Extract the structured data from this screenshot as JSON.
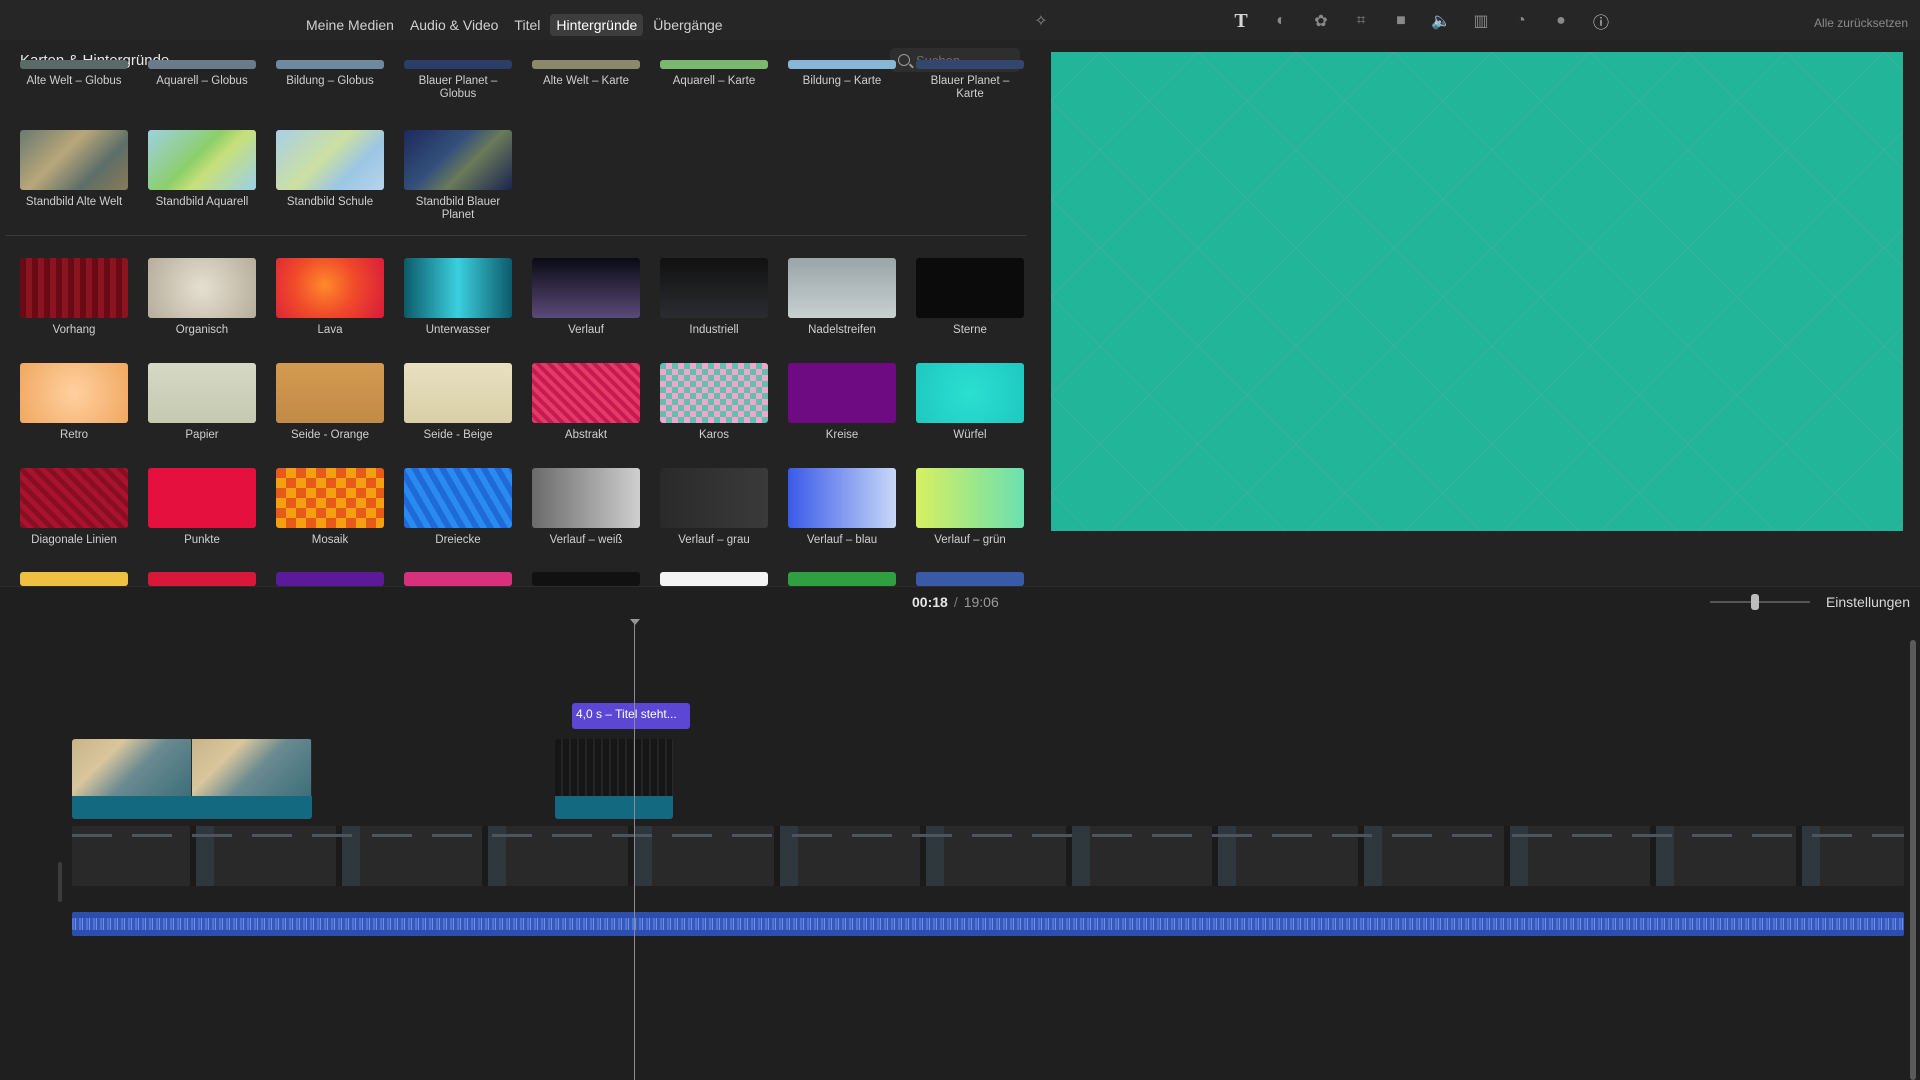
{
  "tabs": [
    {
      "label": "Meine Medien"
    },
    {
      "label": "Audio & Video"
    },
    {
      "label": "Titel"
    },
    {
      "label": "Hintergründe",
      "active": true
    },
    {
      "label": "Übergänge"
    }
  ],
  "toolbar": {
    "icons": [
      "magic-wand-icon",
      "title-T-icon",
      "color-balance-icon",
      "color-correction-icon",
      "crop-icon",
      "stabilization-icon",
      "volume-icon",
      "equalizer-icon",
      "speed-icon",
      "filter-icon",
      "info-icon"
    ],
    "reset_label": "Alle zurücksetzen"
  },
  "browser": {
    "title": "Karten & Hintergründe",
    "search_placeholder": "Suchen",
    "clipped_row": [
      {
        "label": "Alte Welt – Globus",
        "color": "#5a6a66"
      },
      {
        "label": "Aquarell – Globus",
        "color": "#6a7c8a"
      },
      {
        "label": "Bildung – Globus",
        "color": "#6f8aa0"
      },
      {
        "label": "Blauer Planet – Globus",
        "color": "#2c3d6a"
      },
      {
        "label": "Alte Welt – Karte",
        "color": "#8a8a6a"
      },
      {
        "label": "Aquarell – Karte",
        "color": "#7ab870"
      },
      {
        "label": "Bildung – Karte",
        "color": "#88b6d6"
      },
      {
        "label": "Blauer Planet – Karte",
        "color": "#34466e"
      }
    ],
    "maps": [
      {
        "label": "Standbild Alte Welt",
        "bg": "linear-gradient(135deg,#6a7a70,#b9a77a 40%,#5d6e68 70%,#8a7a58)"
      },
      {
        "label": "Standbild Aquarell",
        "bg": "linear-gradient(135deg,#9fd0e0,#8ccf6a 45%,#c8e07a 60%,#9ad0e8)"
      },
      {
        "label": "Standbild Schule",
        "bg": "linear-gradient(135deg,#a8cfe6,#cde0a0 45%,#9cc6e4 70%,#b6d4ec)"
      },
      {
        "label": "Standbild Blauer Planet",
        "bg": "linear-gradient(135deg,#1c2a5e,#34507a 40%,#6a7a5a 60%,#1a2450)"
      }
    ],
    "backgrounds": [
      {
        "label": "Vorhang",
        "bg": "repeating-linear-gradient(90deg,#6a0a14 0 6px,#8a1420 6px 12px)"
      },
      {
        "label": "Organisch",
        "bg": "radial-gradient(circle,#e6e0d2,#b6ad9a)"
      },
      {
        "label": "Lava",
        "bg": "radial-gradient(circle at 45% 45%,#ff8a2a,#f04a2a 45%,#d81a3a)"
      },
      {
        "label": "Unterwasser",
        "bg": "linear-gradient(90deg,#0d5a6a,#3ad0e0 50%,#0d5a6a)"
      },
      {
        "label": "Verlauf",
        "bg": "linear-gradient(180deg,#0a0a14,#5a4a78)"
      },
      {
        "label": "Industriell",
        "bg": "linear-gradient(180deg,#111,#2a2c30)"
      },
      {
        "label": "Nadelstreifen",
        "bg": "linear-gradient(180deg,#9aa5a8,#c8d0d0)"
      },
      {
        "label": "Sterne",
        "bg": "#0b0b0b"
      },
      {
        "label": "Retro",
        "bg": "radial-gradient(circle,#ffd0a0,#f0a860)"
      },
      {
        "label": "Papier",
        "bg": "linear-gradient(180deg,#d6d9c4,#c5c9b0)"
      },
      {
        "label": "Seide - Orange",
        "bg": "linear-gradient(180deg,#d39a50,#c28a48)"
      },
      {
        "label": "Seide - Beige",
        "bg": "linear-gradient(180deg,#e8e0c0,#d9cfa8)"
      },
      {
        "label": "Abstrakt",
        "bg": "repeating-linear-gradient(45deg,#e43a6a 0 4px,#c81a50 4px 8px)"
      },
      {
        "label": "Karos",
        "bg": "repeating-conic-gradient(#f3a6cc 0 25%,#5fc0b0 0 50%) 0 0/12px 12px"
      },
      {
        "label": "Kreise",
        "bg": "#6e0a82"
      },
      {
        "label": "Würfel",
        "bg": "radial-gradient(circle,#2ae0d0,#1fc8c0)"
      },
      {
        "label": "Diagonale Linien",
        "bg": "repeating-linear-gradient(45deg,#8a0e22 0 5px,#a8142e 5px 10px)"
      },
      {
        "label": "Punkte",
        "bg": "#e6103e"
      },
      {
        "label": "Mosaik",
        "bg": "repeating-conic-gradient(#f5a010 0 25%,#e85a1a 0 50%) 0 0/20px 20px"
      },
      {
        "label": "Dreiecke",
        "bg": "repeating-linear-gradient(60deg,#1e6ad8 0 6px,#2a8af0 6px 12px)"
      },
      {
        "label": "Verlauf – weiß",
        "bg": "linear-gradient(90deg,#6a6a6a,#cfcfcf)"
      },
      {
        "label": "Verlauf – grau",
        "bg": "linear-gradient(90deg,#2a2a2a,#3a3a3a)"
      },
      {
        "label": "Verlauf – blau",
        "bg": "linear-gradient(90deg,#3a5ae8,#c8d8f8)"
      },
      {
        "label": "Verlauf – grün",
        "bg": "linear-gradient(90deg,#d8f060,#6ae0b0)"
      }
    ],
    "bottom_row_colors": [
      "#f0c040",
      "#d8183a",
      "#5a1a9a",
      "#d8307a",
      "#111111",
      "#f4f4f4",
      "#2ea040",
      "#3a5aa8"
    ]
  },
  "timecode": {
    "current": "00:18",
    "separator": "/",
    "duration": "19:06"
  },
  "settings_label": "Einstellungen",
  "timeline": {
    "title_clip": "4,0 s – Titel steht...",
    "zoom_level": 0.45
  },
  "viewer": {
    "pattern": "argyle",
    "colors": [
      "#f8a0d0",
      "#23b59a"
    ]
  }
}
